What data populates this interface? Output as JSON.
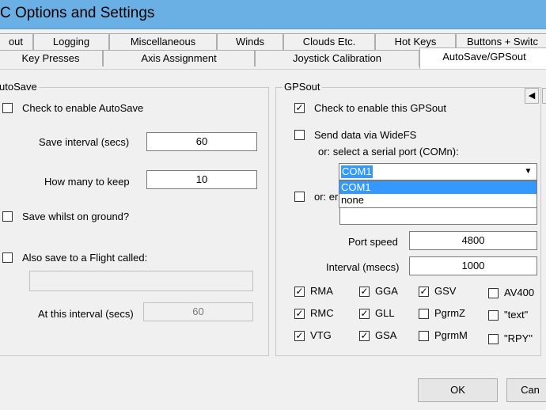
{
  "window": {
    "title": "C Options and Settings"
  },
  "tabs_row1": [
    "out",
    "Logging",
    "Miscellaneous",
    "Winds",
    "Clouds Etc.",
    "Hot Keys",
    "Buttons + Switc"
  ],
  "tabs_row2": [
    "Key Presses",
    "Axis Assignment",
    "Joystick Calibration",
    "AutoSave/GPSout"
  ],
  "autosave": {
    "group_label": "utoSave",
    "enable_label": "Check to enable AutoSave",
    "enable_checked": false,
    "interval_label": "Save interval (secs)",
    "interval_value": "60",
    "keep_label": "How many to keep",
    "keep_value": "10",
    "ground_label": "Save whilst on ground?",
    "ground_checked": false,
    "flight_label": "Also save to a Flight called:",
    "flight_checked": false,
    "flight_value": "",
    "at_interval_label": "At this interval (secs)",
    "at_interval_value": "60"
  },
  "gpsout": {
    "group_label": "GPSout",
    "enable_label": "Check to enable this GPSout",
    "enable_checked": true,
    "widefs_label": "Send data via WideFS",
    "widefs_checked": false,
    "serial_label": "or: select a serial port (COMn):",
    "com_selected": "COM1",
    "com_options": [
      "COM1",
      "none"
    ],
    "or_label": "or: er",
    "or_checked": false,
    "port_speed_label": "Port speed",
    "port_speed_value": "4800",
    "interval_label": "Interval (msecs)",
    "interval_value": "1000",
    "sentences": [
      {
        "label": "RMA",
        "checked": true
      },
      {
        "label": "GGA",
        "checked": true
      },
      {
        "label": "GSV",
        "checked": true
      },
      {
        "label": "AV400",
        "checked": false
      },
      {
        "label": "RMC",
        "checked": true
      },
      {
        "label": "GLL",
        "checked": true
      },
      {
        "label": "PgrmZ",
        "checked": false
      },
      {
        "label": "\"text\"",
        "checked": false
      },
      {
        "label": "VTG",
        "checked": true
      },
      {
        "label": "GSA",
        "checked": true
      },
      {
        "label": "PgrmM",
        "checked": false
      },
      {
        "label": "\"RPY\"",
        "checked": false
      }
    ]
  },
  "buttons": {
    "ok": "OK",
    "cancel": "Can"
  },
  "icons": {
    "scroll_left": "◀",
    "check": "✓",
    "dropdown": "▼"
  }
}
